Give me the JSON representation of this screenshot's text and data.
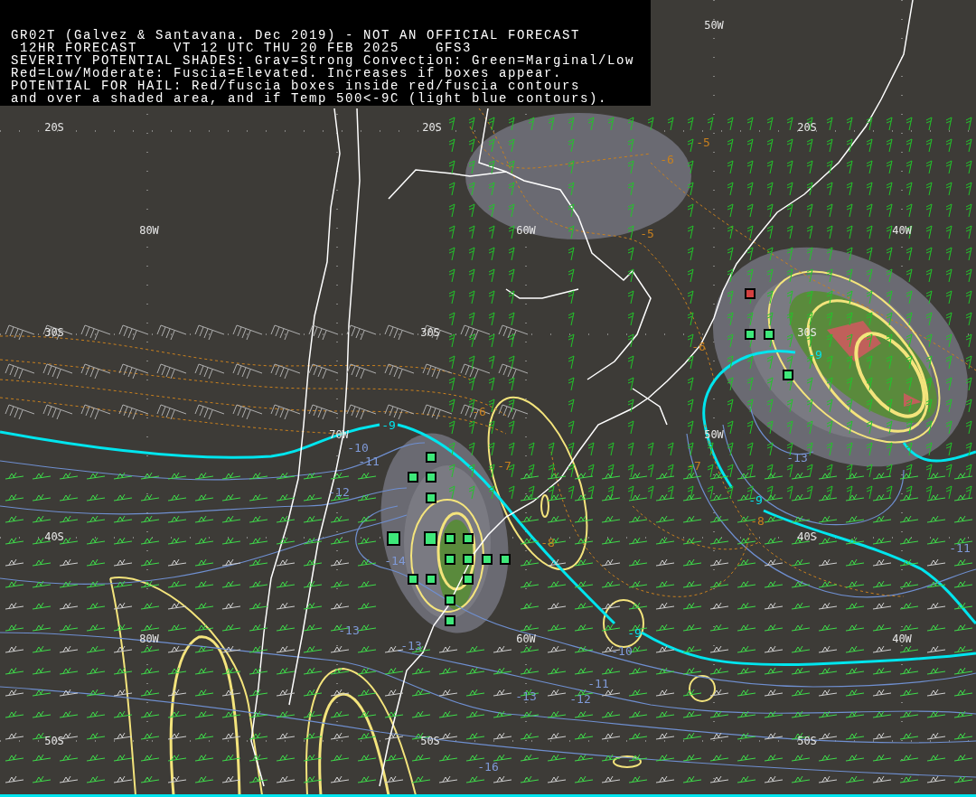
{
  "header": {
    "title": "GR02T (Galvez & Santavana. Dec 2019) - NOT AN OFFICIAL FORECAST",
    "forecast_line": "12HR FORECAST    VT 12 UTC THU 20 FEB 2025    GFS3",
    "legend_lines": [
      "SEVERITY POTENTIAL SHADES: Grav=Strong Convection: Green=Marginal/Low",
      "Red=Low/Moderate: Fuscia=Elevated. Increases if boxes appear.",
      "POTENTIAL FOR HAIL: Red/fuscia boxes inside red/fuscia contours",
      "and over a shaded area, and if Temp 500<-9C (light blue contours)."
    ]
  },
  "grid_labels": [
    "50W",
    "20S",
    "20S",
    "20S",
    "80W",
    "60W",
    "40W",
    "30S",
    "30S",
    "30S",
    "70W",
    "50W",
    "40S",
    "40S",
    "80W",
    "60W",
    "40W",
    "50S",
    "50S",
    "50S"
  ],
  "contour_labels": [
    {
      "text": "-5",
      "color": "#c8801e"
    },
    {
      "text": "-6",
      "color": "#c8801e"
    },
    {
      "text": "-5",
      "color": "#c8801e"
    },
    {
      "text": "-6",
      "color": "#c8801e"
    },
    {
      "text": "-6",
      "color": "#c8801e"
    },
    {
      "text": "-7",
      "color": "#c8801e"
    },
    {
      "text": "-7",
      "color": "#c8801e"
    },
    {
      "text": "-8",
      "color": "#c8801e"
    },
    {
      "text": "-8",
      "color": "#c8801e"
    },
    {
      "text": "-9",
      "color": "#00e5ee"
    },
    {
      "text": "-9",
      "color": "#00e5ee"
    },
    {
      "text": "-9",
      "color": "#00e5ee"
    },
    {
      "text": "-9",
      "color": "#00e5ee"
    },
    {
      "text": "-10",
      "color": "#7f9ad8"
    },
    {
      "text": "-11",
      "color": "#7f9ad8"
    },
    {
      "text": "-12",
      "color": "#7f9ad8"
    },
    {
      "text": "-14",
      "color": "#7f9ad8"
    },
    {
      "text": "-13",
      "color": "#7f9ad8"
    },
    {
      "text": "-13",
      "color": "#7f9ad8"
    },
    {
      "text": "-13",
      "color": "#7f9ad8"
    },
    {
      "text": "-10",
      "color": "#7f9ad8"
    },
    {
      "text": "-11",
      "color": "#7f9ad8"
    },
    {
      "text": "-13",
      "color": "#7f9ad8"
    },
    {
      "text": "-12",
      "color": "#7f9ad8"
    },
    {
      "text": "-16",
      "color": "#7f9ad8"
    },
    {
      "text": "-11",
      "color": "#7f9ad8"
    }
  ]
}
